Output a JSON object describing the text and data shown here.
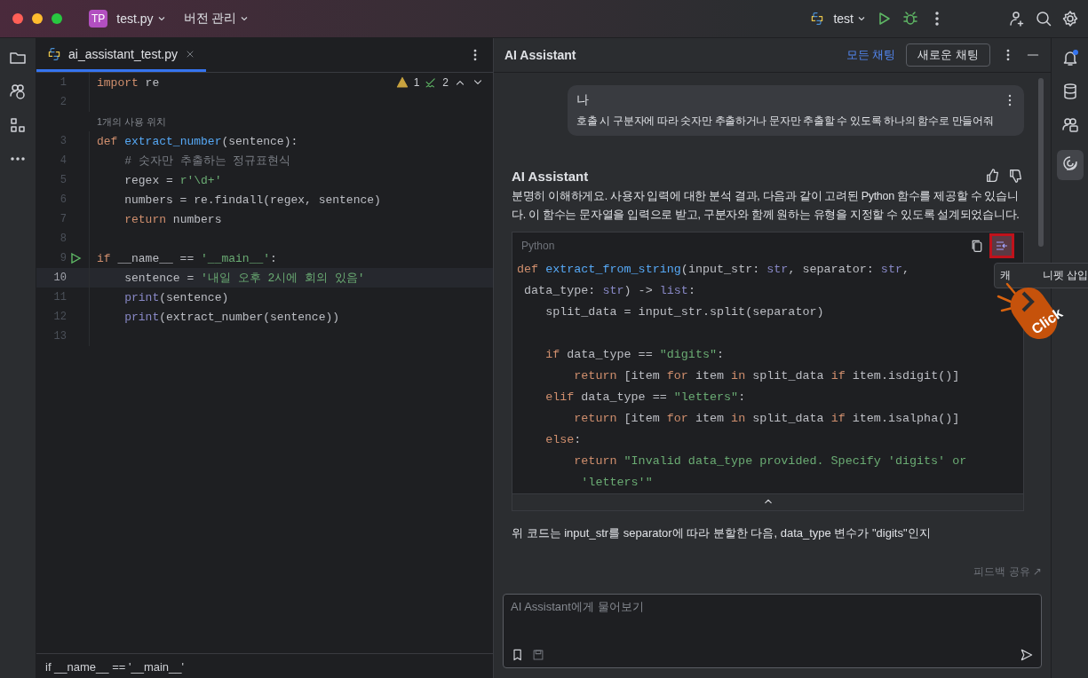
{
  "title_bar": {
    "project_badge": "TP",
    "project": "test.py",
    "vcs": "버전 관리",
    "run_config": "test"
  },
  "editor": {
    "tab": {
      "label": "ai_assistant_test.py",
      "selected": true
    },
    "inspections": {
      "warnings": "1",
      "weak_warnings": "2"
    },
    "lines": [
      {
        "kind": "code",
        "number": "1",
        "current": false,
        "run_gutter": false,
        "tokens": [
          {
            "kind": "keyword",
            "t": "import "
          },
          {
            "kind": "plain",
            "t": "re"
          }
        ]
      },
      {
        "kind": "blank",
        "number": "2",
        "current": false,
        "run_gutter": false
      },
      {
        "kind": "hint",
        "text": "1개의 사용 위치"
      },
      {
        "kind": "code",
        "number": "3",
        "current": false,
        "run_gutter": false,
        "tokens": [
          {
            "kind": "keyword",
            "t": "def "
          },
          {
            "kind": "function",
            "t": "extract_number"
          },
          {
            "kind": "plain",
            "t": "(sentence):"
          }
        ]
      },
      {
        "kind": "code",
        "number": "4",
        "current": false,
        "run_gutter": false,
        "tokens": [
          {
            "kind": "comment",
            "t": "    # 숫자만 추출하는 정규표현식"
          }
        ]
      },
      {
        "kind": "code",
        "number": "5",
        "current": false,
        "run_gutter": false,
        "tokens": [
          {
            "kind": "plain",
            "t": "    regex = "
          },
          {
            "kind": "string",
            "t": "r'\\d+'"
          }
        ]
      },
      {
        "kind": "code",
        "number": "6",
        "current": false,
        "run_gutter": false,
        "tokens": [
          {
            "kind": "plain",
            "t": "    numbers = re.findall(regex, sentence)"
          }
        ]
      },
      {
        "kind": "code",
        "number": "7",
        "current": false,
        "run_gutter": false,
        "tokens": [
          {
            "kind": "keyword",
            "t": "    return "
          },
          {
            "kind": "plain",
            "t": "numbers"
          }
        ]
      },
      {
        "kind": "blank",
        "number": "8",
        "current": false,
        "run_gutter": false
      },
      {
        "kind": "code",
        "number": "9",
        "current": false,
        "run_gutter": true,
        "tokens": [
          {
            "kind": "keyword",
            "t": "if "
          },
          {
            "kind": "plain",
            "t": "__name__ == "
          },
          {
            "kind": "string",
            "t": "'__main__'"
          },
          {
            "kind": "plain",
            "t": ":"
          }
        ]
      },
      {
        "kind": "code",
        "number": "10",
        "current": true,
        "run_gutter": false,
        "tokens": [
          {
            "kind": "plain",
            "t": "    sentence = "
          },
          {
            "kind": "string",
            "t": "'내일 오후 2시에 회의 있음'"
          }
        ]
      },
      {
        "kind": "code",
        "number": "11",
        "current": false,
        "run_gutter": false,
        "tokens": [
          {
            "kind": "builtin",
            "t": "    print"
          },
          {
            "kind": "plain",
            "t": "(sentence)"
          }
        ]
      },
      {
        "kind": "code",
        "number": "12",
        "current": false,
        "run_gutter": false,
        "tokens": [
          {
            "kind": "builtin",
            "t": "    print"
          },
          {
            "kind": "plain",
            "t": "(extract_number(sentence))"
          }
        ]
      },
      {
        "kind": "blank",
        "number": "13",
        "current": false,
        "run_gutter": false
      }
    ],
    "breadcrumb": "if __name__ == '__main__'"
  },
  "assistant": {
    "title": "AI Assistant",
    "all_chats": "모든 채팅",
    "new_chat": "새로운 채팅",
    "user_message": {
      "author": "나",
      "text": "호출 시 구분자에 따라 숫자만 추출하거나 문자만 추출할 수 있도록 하나의 함수로 만들어줘"
    },
    "reply": {
      "author": "AI Assistant",
      "intro": "분명히 이해하게요. 사용자 입력에 대한 분석 결과, 다음과 같이 고려된 Python 함수를 제공할 수 있습니다. 이 함수는 문자열을 입력으로 받고, 구분자와 함께 원하는 유형을 지정할 수 있도록 설계되었습니다.",
      "code_language": "Python",
      "code_lines": [
        {
          "kind": "code",
          "tokens": [
            {
              "kind": "keyword",
              "t": "def "
            },
            {
              "kind": "function",
              "t": "extract_from_string"
            },
            {
              "kind": "plain",
              "t": "(input_str: "
            },
            {
              "kind": "builtin",
              "t": "str"
            },
            {
              "kind": "plain",
              "t": ", separator: "
            },
            {
              "kind": "builtin",
              "t": "str"
            },
            {
              "kind": "plain",
              "t": ","
            }
          ]
        },
        {
          "kind": "code",
          "tokens": [
            {
              "kind": "plain",
              "t": " data_type: "
            },
            {
              "kind": "builtin",
              "t": "str"
            },
            {
              "kind": "plain",
              "t": ") -> "
            },
            {
              "kind": "builtin",
              "t": "list"
            },
            {
              "kind": "plain",
              "t": ":"
            }
          ]
        },
        {
          "kind": "code",
          "tokens": [
            {
              "kind": "plain",
              "t": "    split_data = input_str.split(separator)"
            }
          ]
        },
        {
          "kind": "blank"
        },
        {
          "kind": "code",
          "tokens": [
            {
              "kind": "keyword",
              "t": "    if "
            },
            {
              "kind": "plain",
              "t": "data_type == "
            },
            {
              "kind": "string",
              "t": "\"digits\""
            },
            {
              "kind": "plain",
              "t": ":"
            }
          ]
        },
        {
          "kind": "code",
          "tokens": [
            {
              "kind": "keyword",
              "t": "        return "
            },
            {
              "kind": "plain",
              "t": "[item "
            },
            {
              "kind": "keyword",
              "t": "for "
            },
            {
              "kind": "plain",
              "t": "item "
            },
            {
              "kind": "keyword",
              "t": "in "
            },
            {
              "kind": "plain",
              "t": "split_data "
            },
            {
              "kind": "keyword",
              "t": "if "
            },
            {
              "kind": "plain",
              "t": "item.isdigit()]"
            }
          ]
        },
        {
          "kind": "code",
          "tokens": [
            {
              "kind": "keyword",
              "t": "    elif "
            },
            {
              "kind": "plain",
              "t": "data_type == "
            },
            {
              "kind": "string",
              "t": "\"letters\""
            },
            {
              "kind": "plain",
              "t": ":"
            }
          ]
        },
        {
          "kind": "code",
          "tokens": [
            {
              "kind": "keyword",
              "t": "        return "
            },
            {
              "kind": "plain",
              "t": "[item "
            },
            {
              "kind": "keyword",
              "t": "for "
            },
            {
              "kind": "plain",
              "t": "item "
            },
            {
              "kind": "keyword",
              "t": "in "
            },
            {
              "kind": "plain",
              "t": "split_data "
            },
            {
              "kind": "keyword",
              "t": "if "
            },
            {
              "kind": "plain",
              "t": "item.isalpha()]"
            }
          ]
        },
        {
          "kind": "code",
          "tokens": [
            {
              "kind": "keyword",
              "t": "    else"
            },
            {
              "kind": "plain",
              "t": ":"
            }
          ]
        },
        {
          "kind": "code",
          "tokens": [
            {
              "kind": "keyword",
              "t": "        return "
            },
            {
              "kind": "string",
              "t": "\"Invalid data_type provided. Specify 'digits' or"
            }
          ]
        },
        {
          "kind": "code",
          "tokens": [
            {
              "kind": "string",
              "t": "         'letters'\""
            }
          ]
        }
      ],
      "tooltip_start": "캐",
      "tooltip_end": "니펫 삽입",
      "click_label": "Click",
      "explanation": "위 코드는 input_str를 separator에 따라 분할한 다음, data_type 변수가 \"digits\"인지"
    },
    "feedback": "피드백 공유 ↗",
    "input_placeholder": "AI Assistant에게 물어보기"
  }
}
